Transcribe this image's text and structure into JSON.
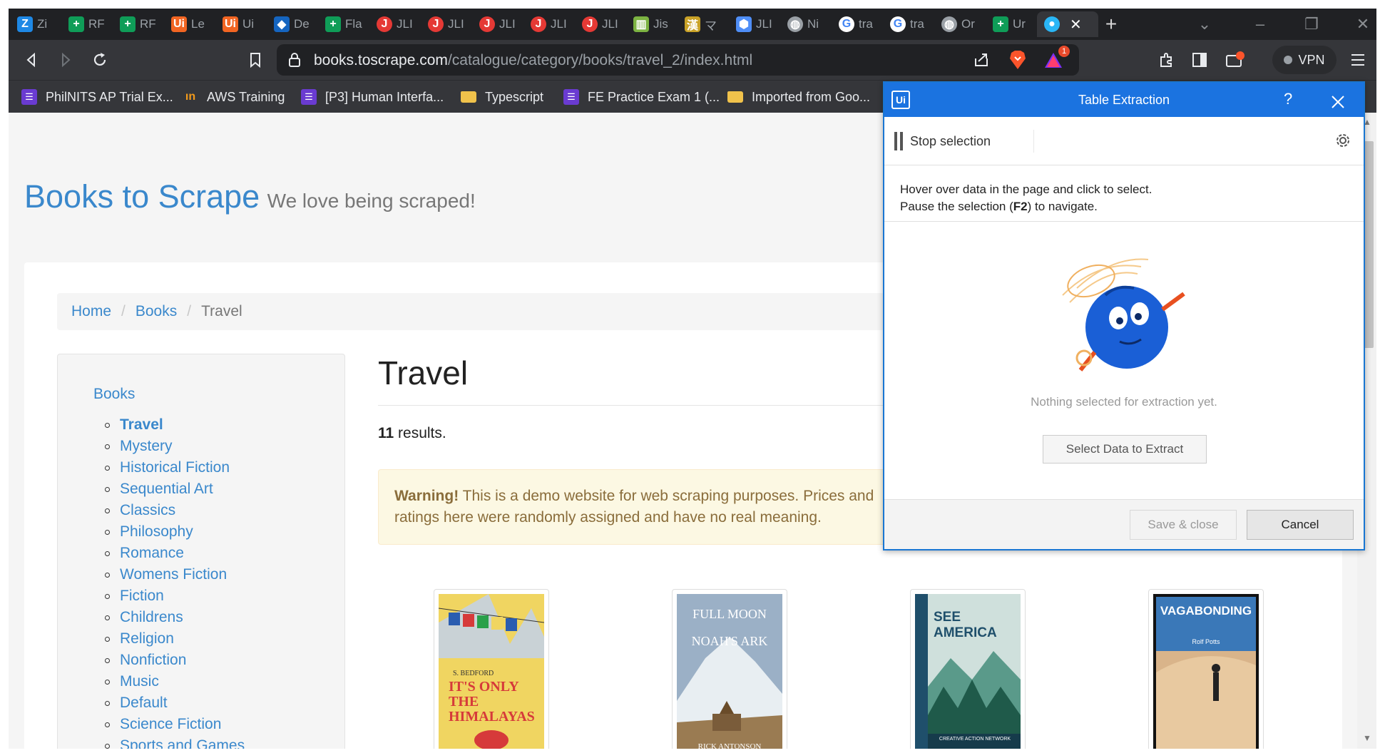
{
  "browser": {
    "tabs": [
      {
        "label": "Zi",
        "icon": "z-icon",
        "color": "#1e88e5",
        "glyph": "Z"
      },
      {
        "label": "RF",
        "icon": "plus-sheet-icon",
        "color": "#0f9d58",
        "glyph": "+"
      },
      {
        "label": "RF",
        "icon": "plus-sheet-icon",
        "color": "#0f9d58",
        "glyph": "+"
      },
      {
        "label": "Le",
        "icon": "uipath-icon",
        "color": "#f26522",
        "glyph": "Ui"
      },
      {
        "label": "Ui",
        "icon": "uipath-icon",
        "color": "#f26522",
        "glyph": "Ui"
      },
      {
        "label": "De",
        "icon": "shield-icon",
        "color": "#1565c0",
        "glyph": "◆"
      },
      {
        "label": "Fla",
        "icon": "plus-sheet-icon",
        "color": "#0f9d58",
        "glyph": "+"
      },
      {
        "label": "JLI",
        "icon": "j-icon",
        "color": "#e53935",
        "glyph": "J"
      },
      {
        "label": "JLI",
        "icon": "j-icon",
        "color": "#e53935",
        "glyph": "J"
      },
      {
        "label": "JLI",
        "icon": "j-icon",
        "color": "#e53935",
        "glyph": "J"
      },
      {
        "label": "JLI",
        "icon": "j-icon",
        "color": "#e53935",
        "glyph": "J"
      },
      {
        "label": "JLI",
        "icon": "j-icon",
        "color": "#e53935",
        "glyph": "J"
      },
      {
        "label": "Jis",
        "icon": "book-icon",
        "color": "#7cb342",
        "glyph": "▥"
      },
      {
        "label": "マ",
        "icon": "kanji-icon",
        "color": "#c9a227",
        "glyph": "漢"
      },
      {
        "label": "JLI",
        "icon": "hex-icon",
        "color": "#4f8ef7",
        "glyph": "⬢"
      },
      {
        "label": "Ni",
        "icon": "globe-icon",
        "color": "#9aa0a6",
        "glyph": "◍"
      },
      {
        "label": "tra",
        "icon": "google-icon",
        "color": "#ffffff",
        "glyph": "G"
      },
      {
        "label": "tra",
        "icon": "google-icon",
        "color": "#ffffff",
        "glyph": "G"
      },
      {
        "label": "Or",
        "icon": "globe-icon",
        "color": "#9aa0a6",
        "glyph": "◍"
      },
      {
        "label": "Ur",
        "icon": "plus-sheet-icon",
        "color": "#0f9d58",
        "glyph": "+"
      },
      {
        "label": "",
        "icon": "cloud-icon",
        "color": "#29b6f6",
        "glyph": "●"
      }
    ],
    "url_domain": "books.toscrape.com",
    "url_path": "/catalogue/category/books/travel_2/index.html",
    "vpn_label": "VPN",
    "brave_badge": "1",
    "bookmarks": [
      {
        "label": "PhilNITS AP Trial Ex...",
        "icon": "list-icon"
      },
      {
        "label": "AWS Training",
        "icon": "aws-icon"
      },
      {
        "label": "[P3] Human Interfa...",
        "icon": "list-icon"
      },
      {
        "label": "Typescript",
        "icon": "folder-icon"
      },
      {
        "label": "FE Practice Exam 1 (...",
        "icon": "list-icon"
      },
      {
        "label": "Imported from Goo...",
        "icon": "folder-icon"
      }
    ]
  },
  "site": {
    "name": "Books to Scrape",
    "tagline": "We love being scraped!",
    "breadcrumb": [
      "Home",
      "Books",
      "Travel"
    ],
    "sidebar_title": "Books",
    "categories": [
      "Travel",
      "Mystery",
      "Historical Fiction",
      "Sequential Art",
      "Classics",
      "Philosophy",
      "Romance",
      "Womens Fiction",
      "Fiction",
      "Childrens",
      "Religion",
      "Nonfiction",
      "Music",
      "Default",
      "Science Fiction",
      "Sports and Games"
    ],
    "active_category": "Travel",
    "heading": "Travel",
    "results_count": "11",
    "results_suffix": " results.",
    "warning_strong": "Warning!",
    "warning_text": " This is a demo website for web scraping purposes. Prices and ratings here were randomly assigned and have no real meaning.",
    "books": [
      {
        "cover_top": "S. BEDFORD",
        "cover_title": "IT'S ONLY THE HIMALAYAS",
        "bg": "#e9c84a"
      },
      {
        "cover_top": "FULL MOON",
        "cover_title": "NOAH'S ARK",
        "cover_bottom": "RICK ANTONSON",
        "bg": "#8aa3bd"
      },
      {
        "cover_top": "SEE AMERICA",
        "cover_title": "CREATIVE ACTION NETWORK",
        "bg": "#1f4f6b"
      },
      {
        "cover_top": "VAGABONDING",
        "cover_title": "Rolf Potts",
        "bg": "#3a78b8"
      }
    ]
  },
  "dialog": {
    "title": "Table Extraction",
    "help": "?",
    "stop_selection": "Stop selection",
    "instruction_line1": "Hover over data in the page and click to select.",
    "instruction_line2_pre": "Pause the selection (",
    "instruction_key": "F2",
    "instruction_line2_post": ") to navigate.",
    "empty_message": "Nothing selected for extraction yet.",
    "select_button": "Select Data to Extract",
    "save_button": "Save & close",
    "cancel_button": "Cancel"
  }
}
